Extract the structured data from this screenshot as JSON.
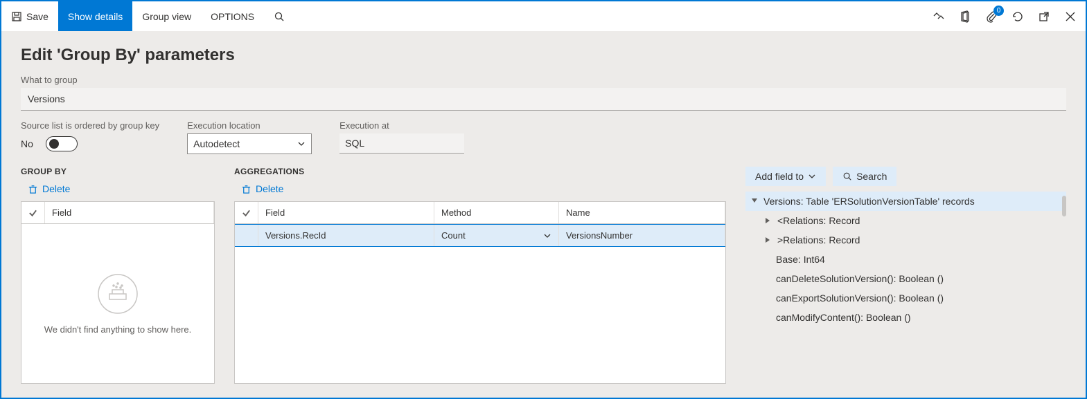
{
  "toolbar": {
    "save_label": "Save",
    "show_details_label": "Show details",
    "group_view_label": "Group view",
    "options_label": "OPTIONS",
    "badge_count": "0"
  },
  "page": {
    "title": "Edit 'Group By' parameters",
    "what_to_group_label": "What to group",
    "what_to_group_value": "Versions",
    "ordered_label": "Source list is ordered by group key",
    "ordered_value": "No",
    "exec_location_label": "Execution location",
    "exec_location_value": "Autodetect",
    "exec_at_label": "Execution at",
    "exec_at_value": "SQL"
  },
  "groupby": {
    "section_label": "GROUP BY",
    "delete_label": "Delete",
    "field_header": "Field",
    "empty_text": "We didn't find anything to show here."
  },
  "agg": {
    "section_label": "AGGREGATIONS",
    "delete_label": "Delete",
    "field_header": "Field",
    "method_header": "Method",
    "name_header": "Name",
    "row_field": "Versions.RecId",
    "row_method": "Count",
    "row_name": "VersionsNumber"
  },
  "tree": {
    "add_field_label": "Add field to",
    "search_label": "Search",
    "root": "Versions: Table 'ERSolutionVersionTable' records",
    "n1": "<Relations: Record",
    "n2": ">Relations: Record",
    "n3": "Base: Int64",
    "n4": "canDeleteSolutionVersion(): Boolean ()",
    "n5": "canExportSolutionVersion(): Boolean ()",
    "n6": "canModifyContent(): Boolean ()"
  }
}
